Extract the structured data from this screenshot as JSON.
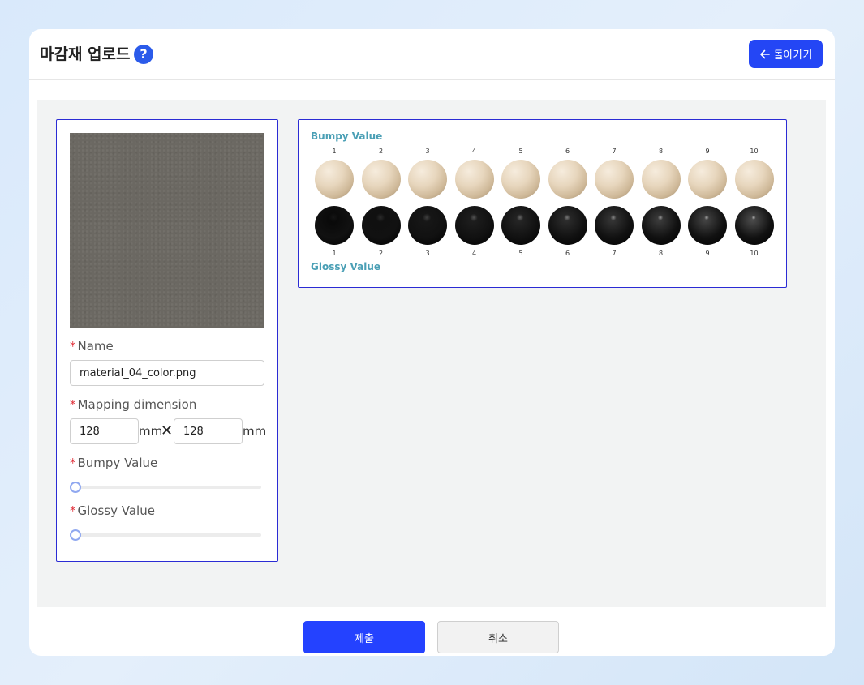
{
  "header": {
    "title": "마감재 업로드",
    "help_label": "?",
    "back_label": "돌아가기"
  },
  "form": {
    "name_label": "Name",
    "name_value": "material_04_color.png",
    "mapping_label": "Mapping dimension",
    "width_value": "128",
    "height_value": "128",
    "unit": "mm",
    "times_symbol": "✕",
    "bumpy_label": "Bumpy Value",
    "bumpy_value": 0,
    "glossy_label": "Glossy Value",
    "glossy_value": 0,
    "required_mark": "*"
  },
  "reference": {
    "bumpy_heading": "Bumpy Value",
    "glossy_heading": "Glossy Value",
    "levels": [
      "1",
      "2",
      "3",
      "4",
      "5",
      "6",
      "7",
      "8",
      "9",
      "10"
    ]
  },
  "footer": {
    "submit_label": "제출",
    "cancel_label": "취소"
  },
  "colors": {
    "accent": "#2446f5",
    "required": "#e0303a",
    "heading": "#4a9fb5"
  }
}
